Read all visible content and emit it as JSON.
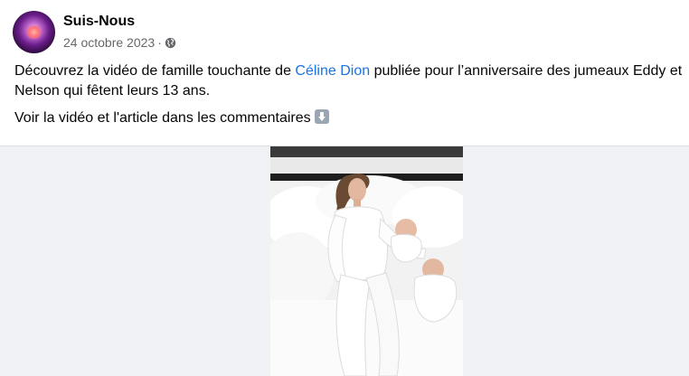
{
  "post": {
    "author": "Suis-Nous",
    "date": "24 octobre 2023",
    "separator": "·",
    "privacy_icon": "globe-icon",
    "text_before_mention": "Découvrez la vidéo de famille touchante de ",
    "mention": "Céline Dion",
    "text_after_mention": " publiée pour l’anniversaire des jumeaux Eddy et Nelson qui fêtent leurs 13 ans.",
    "second_line": "Voir la vidéo et l'article dans les commentaires",
    "emoji": "down-arrow-emoji-icon"
  },
  "colors": {
    "mention": "#1b74e4",
    "secondary_text": "#65676b",
    "media_background": "#f0f2f5"
  }
}
